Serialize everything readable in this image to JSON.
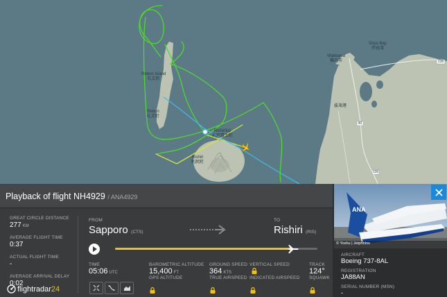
{
  "map": {
    "labels": {
      "wakkanai_en": "Wakkanai",
      "wakkanai_jp": "稚内市",
      "soya_bay_en": "Sōya Bay",
      "soya_bay_jp": "宗谷湾",
      "rebun_en": "Rebun Island",
      "rebun_jp": "礼文町",
      "rebun2_en": "Rebun",
      "rebun2_jp": "礼文町",
      "rishirifuji_en": "Rishirifuji",
      "rishirifuji_jp": "利尻富士町",
      "rishiri_en": "Rishiri",
      "rishiri_jp": "利尻町",
      "bakkai_jp": "抜海港",
      "road_40": "40",
      "road_106": "106",
      "road_238": "238"
    }
  },
  "panel": {
    "title": "Playback of flight NH4929",
    "subtitle": "/ ANA4929",
    "stats": {
      "gcd_label": "GREAT CIRCLE DISTANCE",
      "gcd_value": "277",
      "gcd_unit": "KM",
      "avg_time_label": "AVERAGE FLIGHT TIME",
      "avg_time_value": "0:37",
      "actual_time_label": "ACTUAL FLIGHT TIME",
      "actual_time_value": "-",
      "avg_delay_label": "AVERAGE ARRIVAL DELAY",
      "avg_delay_value": "0:02"
    },
    "route": {
      "from_label": "FROM",
      "from_city": "Sapporo",
      "from_code": "(CTS)",
      "to_label": "TO",
      "to_city": "Rishiri",
      "to_code": "(RIS)"
    },
    "playback": {
      "progress": 0.88
    },
    "metrics": {
      "time_label": "TIME",
      "time_value": "05:06",
      "time_unit": "UTC",
      "baro_label": "BAROMETRIC ALTITUDE",
      "baro_value": "15,400",
      "baro_unit": "FT",
      "gps_label": "GPS ALTITUDE",
      "gs_label": "GROUND SPEED",
      "gs_value": "364",
      "gs_unit": "KTS",
      "tas_label": "TRUE AIRSPEED",
      "vs_label": "VERTICAL SPEED",
      "ias_label": "INDICATED AIRSPEED",
      "track_label": "TRACK",
      "track_value": "124°",
      "squawk_label": "SQUAWK"
    },
    "logo": {
      "text_main": "flightradar",
      "text_num": "24"
    }
  },
  "aircraft": {
    "photo_credit": "© Yoshu | Jetphotos",
    "aircraft_label": "AIRCRAFT",
    "aircraft_value": "Boeing 737-8AL",
    "registration_label": "REGISTRATION",
    "registration_value": "JA88AN",
    "serial_label": "SERIAL NUMBER (MSN)",
    "serial_value": "-"
  },
  "colors": {
    "track_green": "#4ddb2b",
    "track_yellow": "#d6e23a",
    "track_blue": "#3fb8e6",
    "progress_yellow": "#f2c21b",
    "accent_blue": "#1e88d6",
    "aircraft_yellow": "#f6c91c",
    "sea": "#5b7a85",
    "land": "#bcc3b3"
  }
}
